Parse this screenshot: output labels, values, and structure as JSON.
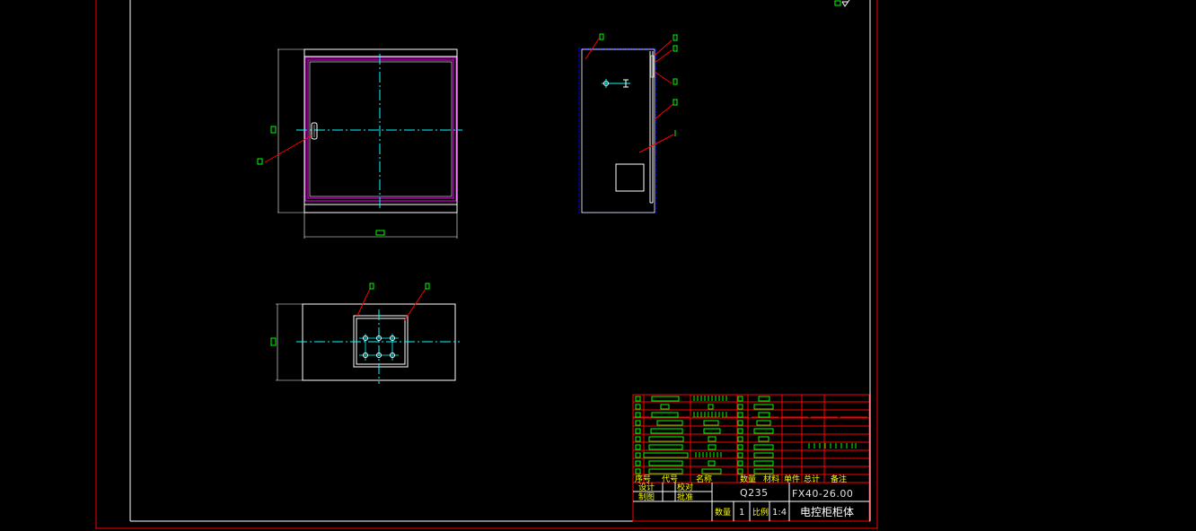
{
  "title_block": {
    "material": "Q235",
    "drawing_number": "FX40-26.00",
    "part_name": "电控柜柜体",
    "quantity_label": "数量",
    "quantity_value": "1",
    "scale_label": "比例",
    "scale_value": "1:4",
    "designer_label": "设计",
    "checker_label": "校对",
    "drafter_label": "制图",
    "approver_label": "批准"
  },
  "parts_header": [
    "序号",
    "代号",
    "名称",
    "数量",
    "材料",
    "单件",
    "总计",
    "备注"
  ],
  "colors": {
    "background": "#000000",
    "frame": "#ff0000",
    "outline": "#ffffff",
    "centerline": "#00ffff",
    "annotation": "#00ff00",
    "leader": "#ff0000",
    "door_seal": "#ff00ff",
    "hidden": "#0000ff"
  }
}
